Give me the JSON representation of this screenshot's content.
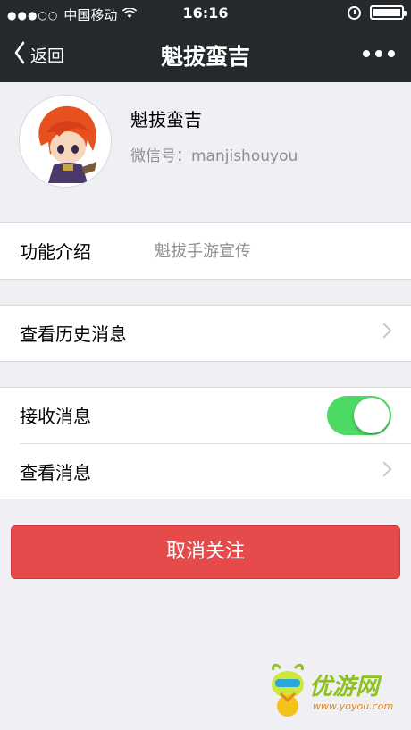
{
  "status_bar": {
    "signal": "●●●○○",
    "carrier": "中国移动",
    "time": "16:16"
  },
  "nav": {
    "back_label": "返回",
    "title": "魁拔蛮吉"
  },
  "profile": {
    "name": "魁拔蛮吉",
    "wechat_id": "微信号：manjishouyou"
  },
  "intro": {
    "label": "功能介绍",
    "value": "魁拔手游宣传"
  },
  "history": {
    "label": "查看历史消息"
  },
  "receive": {
    "label": "接收消息",
    "enabled": true
  },
  "view": {
    "label": "查看消息"
  },
  "unfollow_label": "取消关注",
  "watermark": {
    "brand": "优游网",
    "url": "www.yoyou.com"
  },
  "colors": {
    "bar": "#26292c",
    "background": "#efeff4",
    "toggle_on": "#4cd964",
    "danger": "#e64b4b"
  }
}
